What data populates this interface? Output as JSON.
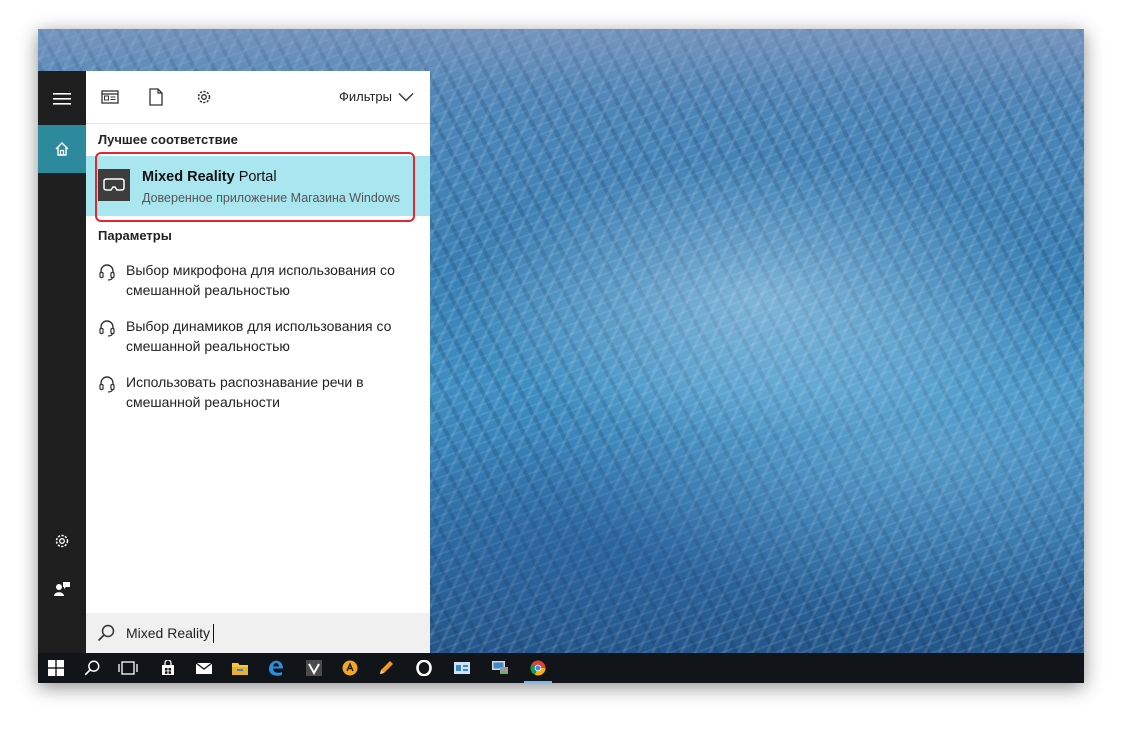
{
  "toolbar": {
    "icons": [
      "apps-icon",
      "document-icon",
      "gear-icon"
    ],
    "filters_label": "Фильтры"
  },
  "best_match": {
    "section_title": "Лучшее соответствие",
    "app_name_bold": "Mixed Reality",
    "app_name_rest": " Portal",
    "app_subtitle": "Доверенное приложение Магазина Windows",
    "highlight_color": "#a9e6ef",
    "outline_color": "#e0282e"
  },
  "settings": {
    "section_title": "Параметры",
    "items": [
      {
        "label": "Выбор микрофона для использования со смешанной реальностью",
        "icon": "headset-icon"
      },
      {
        "label": "Выбор динамиков для использования со смешанной реальностью",
        "icon": "headset-icon"
      },
      {
        "label": "Использовать распознавание речи в смешанной реальности",
        "icon": "headset-icon"
      }
    ]
  },
  "search": {
    "value": "Mixed Reality"
  },
  "rail": {
    "items": [
      "hamburger-menu-icon",
      "home-icon",
      "gear-icon",
      "feedback-icon"
    ],
    "accent_color": "#2d8a9d"
  },
  "taskbar": {
    "items": [
      "windows-start-icon",
      "search-icon",
      "task-view-icon",
      "store-icon",
      "mail-icon",
      "file-explorer-icon",
      "edge-icon",
      "vivaldi-icon",
      "aimp-icon",
      "pencil-icon",
      "opera-icon",
      "app-icon",
      "network-icon",
      "chrome-icon"
    ]
  }
}
